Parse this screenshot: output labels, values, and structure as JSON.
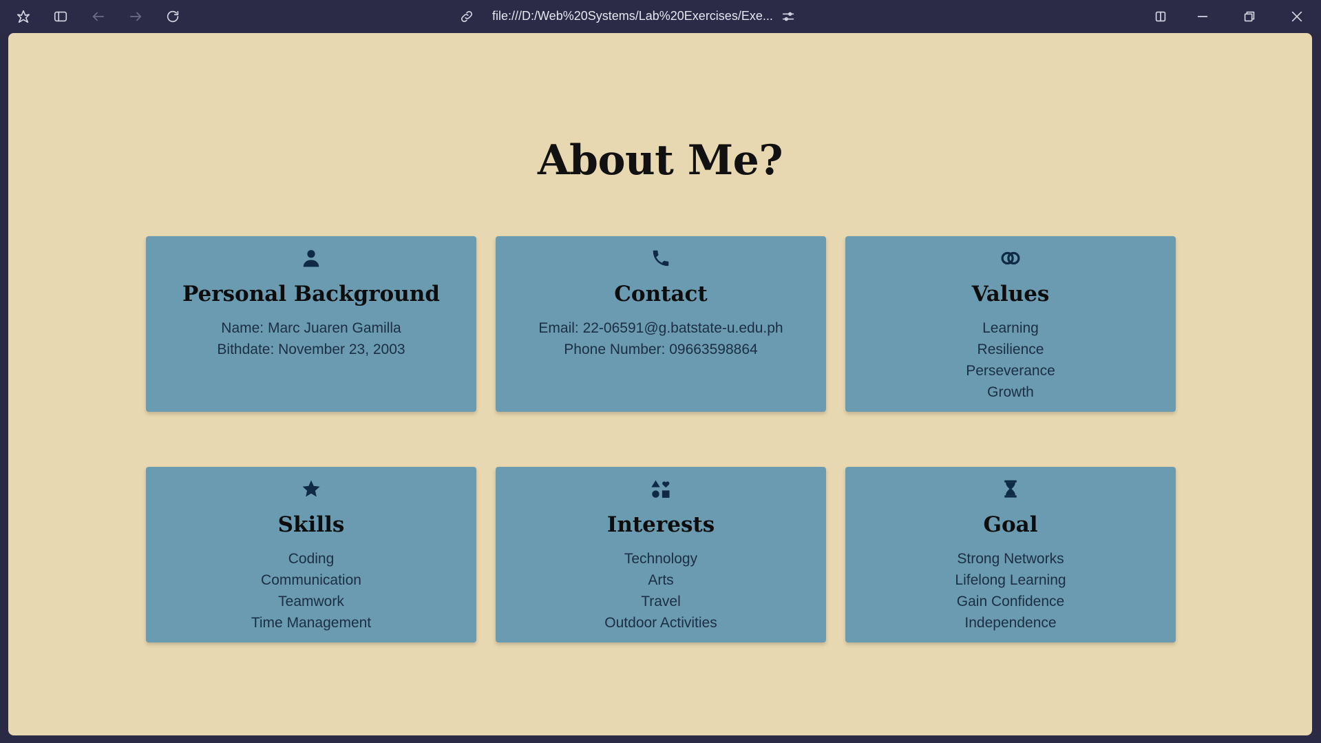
{
  "browser": {
    "url": "file:///D:/Web%20Systems/Lab%20Exercises/Exe..."
  },
  "page": {
    "title": "About Me?"
  },
  "cards": [
    {
      "icon": "person-icon",
      "title": "Personal Background",
      "lines": [
        "Name: Marc Juaren Gamilla",
        "Bithdate: November 23, 2003"
      ]
    },
    {
      "icon": "phone-icon",
      "title": "Contact",
      "lines": [
        "Email: 22-06591@g.batstate-u.edu.ph",
        "Phone Number: 09663598864"
      ]
    },
    {
      "icon": "interlocking-rings-icon",
      "title": "Values",
      "lines": [
        "Learning",
        "Resilience",
        "Perseverance",
        "Growth"
      ]
    },
    {
      "icon": "star-icon",
      "title": "Skills",
      "lines": [
        "Coding",
        "Communication",
        "Teamwork",
        "Time Management"
      ]
    },
    {
      "icon": "shapes-icon",
      "title": "Interests",
      "lines": [
        "Technology",
        "Arts",
        "Travel",
        "Outdoor Activities"
      ]
    },
    {
      "icon": "hourglass-icon",
      "title": "Goal",
      "lines": [
        "Strong Networks",
        "Lifelong Learning",
        "Gain Confidence",
        "Independence"
      ]
    }
  ],
  "colors": {
    "page_background": "#e8d8b1",
    "card_background": "#6a9bb0",
    "icon_color": "#0f2a44",
    "chrome_background": "#2b2b47"
  }
}
